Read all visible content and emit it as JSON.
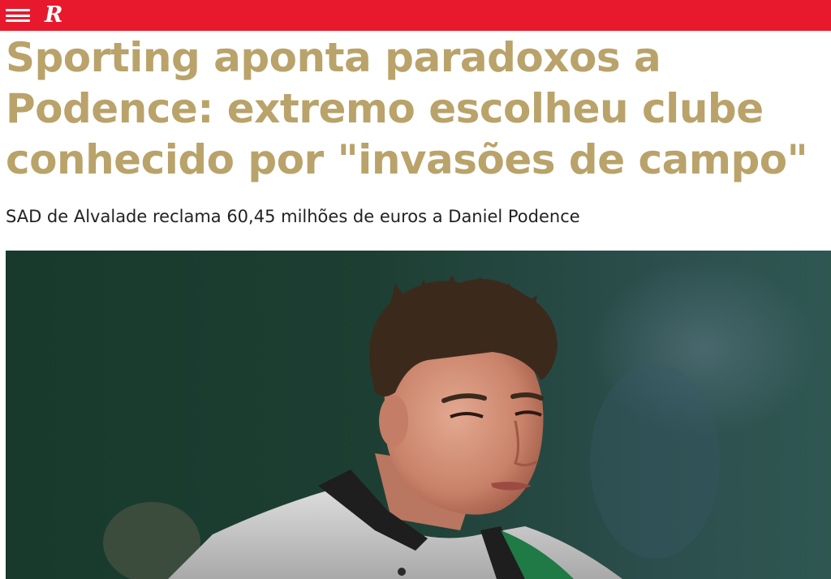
{
  "header": {
    "menu_icon": "hamburger-menu-icon",
    "logo_text": "R",
    "brand_color": "#e8192c"
  },
  "article": {
    "headline": "Sporting aponta paradoxos a Podence: extremo escolheu clube conhecido por \"invasões de campo\"",
    "subtitle": "SAD de Alvalade reclama 60,45 milhões de euros a Daniel Podence",
    "headline_color": "#b9a36a"
  },
  "photo": {
    "subject": "player-photo"
  }
}
